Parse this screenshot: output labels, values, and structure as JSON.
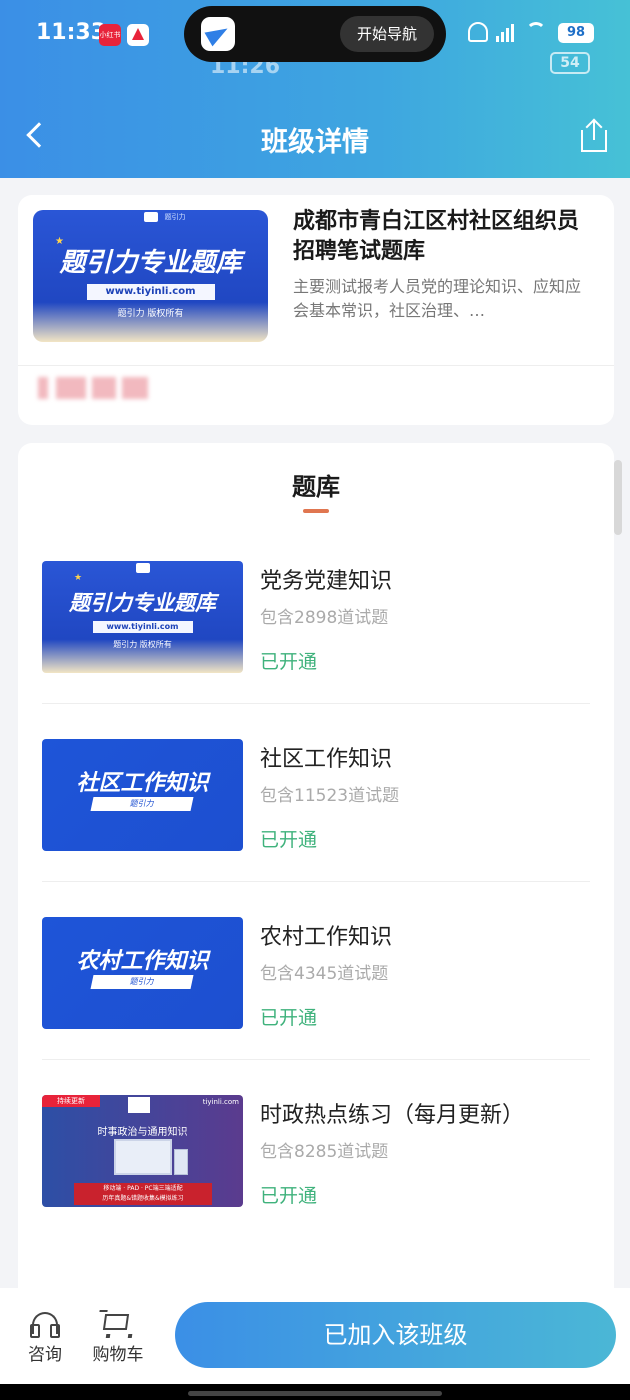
{
  "status_bar": {
    "time": "11:33",
    "ghost_time": "11:26",
    "notification_app": "小红书",
    "navigation_button": "开始导航",
    "battery": "98",
    "ghost_battery": "54"
  },
  "header": {
    "title": "班级详情"
  },
  "course": {
    "cover": {
      "main_text": "题引力专业题库",
      "url": "www.tiyinli.com",
      "copyright": "题引力 版权所有",
      "brand": "题引力"
    },
    "title": "成都市青白江区村社区组织员招聘笔试题库",
    "description": "主要测试报考人员党的理论知识、应知应会基本常识，社区治理、…"
  },
  "question_bank": {
    "title": "题库",
    "items": [
      {
        "name": "党务党建知识",
        "count": "包含2898道试题",
        "status": "已开通",
        "cover_type": "brand",
        "cover_text": "题引力专业题库",
        "cover_url": "www.tiyinli.com",
        "cover_copyright": "题引力 版权所有"
      },
      {
        "name": "社区工作知识",
        "count": "包含11523道试题",
        "status": "已开通",
        "cover_type": "topic",
        "cover_text": "社区工作知识",
        "cover_sub": "题引力"
      },
      {
        "name": "农村工作知识",
        "count": "包含4345道试题",
        "status": "已开通",
        "cover_type": "topic",
        "cover_text": "农村工作知识",
        "cover_sub": "题引力"
      },
      {
        "name": "时政热点练习（每月更新）",
        "count": "包含8285道试题",
        "status": "已开通",
        "cover_type": "news",
        "cover_tag": "持续更新",
        "cover_site": "tiyinli.com",
        "cover_headline": "时事政治与通用知识",
        "cover_ribbon_1": "移动端 · PAD · PC端三端适配",
        "cover_ribbon_2": "历年真题&错题收集&模拟练习"
      }
    ]
  },
  "bottom_bar": {
    "consult_label": "咨询",
    "cart_label": "购物车",
    "join_button": "已加入该班级"
  },
  "colors": {
    "header_start": "#3b8fe6",
    "header_end": "#46c1d6",
    "opened_green": "#3fb27c",
    "accent_underline": "#e07650"
  }
}
